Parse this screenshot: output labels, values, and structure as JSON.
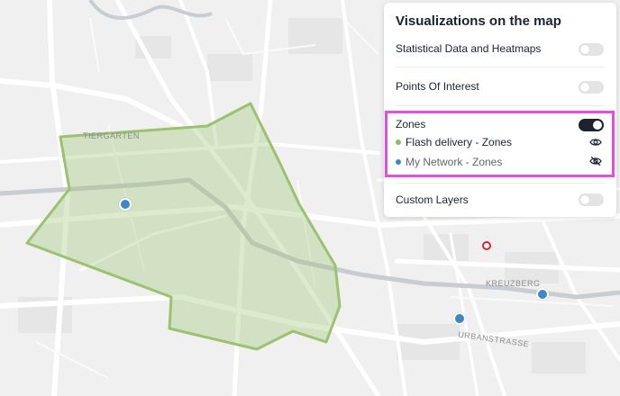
{
  "map": {
    "labels": {
      "tiergarten": "TIERGARTEN",
      "kreuzberg": "KREUZBERG",
      "urbanstrasse": "URBANSTRASSE"
    },
    "zone_color": "#9cc26f",
    "poi_color": "#3d87c8",
    "poi_alt_color": "#d8262c"
  },
  "panel": {
    "title": "Visualizations on the map",
    "sections": {
      "statistical": {
        "label": "Statistical Data and Heatmaps",
        "enabled": false
      },
      "poi": {
        "label": "Points Of Interest",
        "enabled": false
      },
      "zones": {
        "label": "Zones",
        "enabled": true,
        "items": [
          {
            "label": "Flash delivery - Zones",
            "color": "#8fbd63",
            "visible": true,
            "icon": "eye-icon"
          },
          {
            "label": "My Network - Zones",
            "color": "#3d87c8",
            "visible": false,
            "icon": "eye-off-icon"
          }
        ]
      },
      "custom": {
        "label": "Custom Layers",
        "enabled": false
      }
    },
    "highlight_color": "#e44ce4"
  }
}
